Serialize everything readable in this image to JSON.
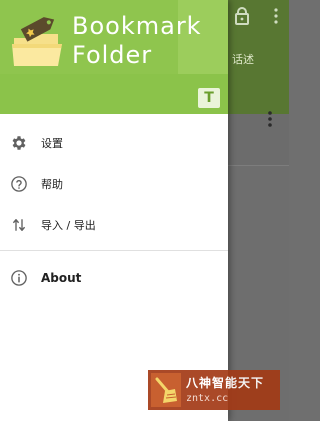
{
  "colors": {
    "header": "#8bc34a",
    "scrim": "#6e6e6e",
    "icon": "#616161",
    "text": "#212121"
  },
  "background": {
    "lock_icon": "lock-icon",
    "more_icon": "more-vert-icon",
    "text_fragment": "话述"
  },
  "drawer": {
    "header": {
      "logo_icon": "bookmark-folder-logo-icon",
      "title_line1": "Bookmark",
      "title_line2": "Folder",
      "badge_letter": "T"
    },
    "items": [
      {
        "icon": "gear-icon",
        "label": "设置"
      },
      {
        "icon": "help-circle-icon",
        "label": "帮助"
      },
      {
        "icon": "import-export-icon",
        "label": "导入 / 导出"
      }
    ],
    "secondary_items": [
      {
        "icon": "info-icon",
        "label": "About"
      }
    ]
  },
  "watermark": {
    "logo_icon": "broom-logo-icon",
    "line1": "八神智能天下",
    "line2": "zntx.cc"
  }
}
